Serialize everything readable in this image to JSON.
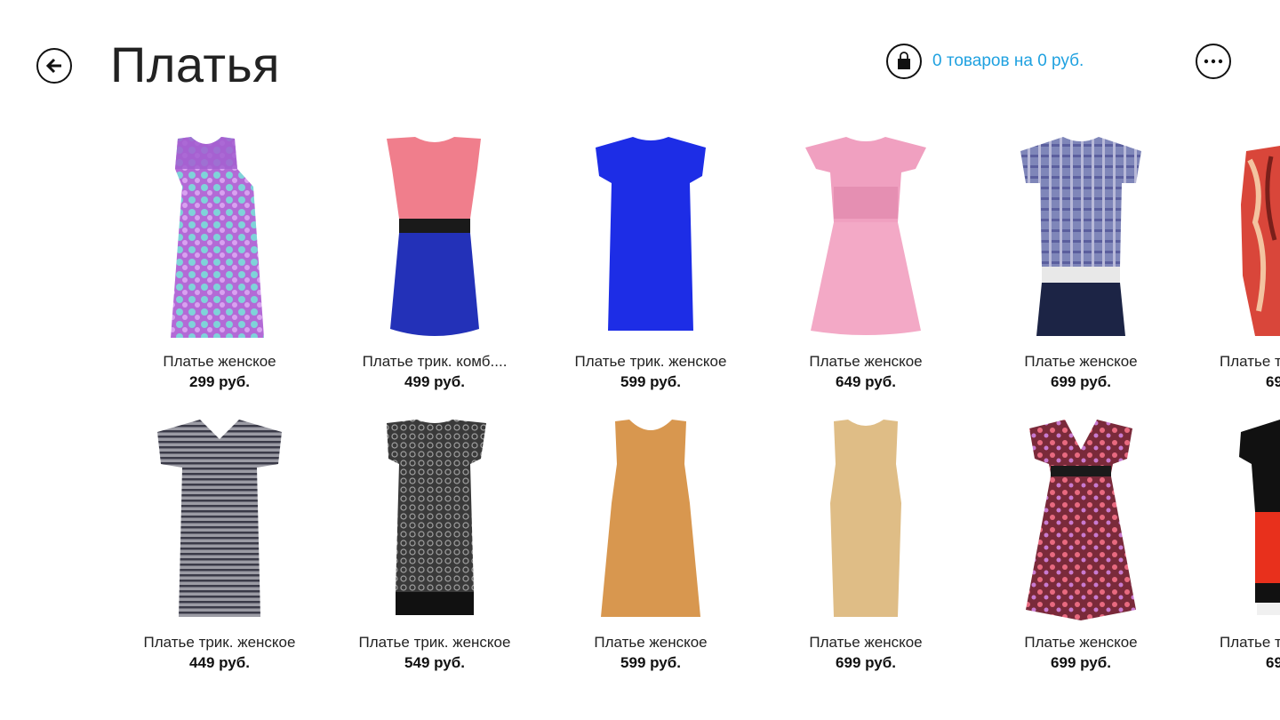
{
  "header": {
    "title": "Платья",
    "cart_summary": "0 товаров на 0 руб."
  },
  "colors": {
    "accent": "#1fa1e0"
  },
  "products": [
    {
      "name": "Платье женское",
      "price": "299 руб.",
      "icon": "sequin-dress-icon"
    },
    {
      "name": "Платье трик. комб....",
      "price": "499 руб.",
      "icon": "pink-blue-dress-icon"
    },
    {
      "name": "Платье трик. женское",
      "price": "599 руб.",
      "icon": "blue-dress-icon"
    },
    {
      "name": "Платье женское",
      "price": "649 руб.",
      "icon": "pink-dress-icon"
    },
    {
      "name": "Платье женское",
      "price": "699 руб.",
      "icon": "plaid-dress-icon"
    },
    {
      "name": "Платье т",
      "price": "69",
      "icon": "print-dress-icon"
    },
    {
      "name": "Платье трик. женское",
      "price": "449 руб.",
      "icon": "striped-dress-icon"
    },
    {
      "name": "Платье трик. женское",
      "price": "549 руб.",
      "icon": "lace-dress-icon"
    },
    {
      "name": "Платье женское",
      "price": "599 руб.",
      "icon": "orange-dress-icon"
    },
    {
      "name": "Платье женское",
      "price": "699 руб.",
      "icon": "beige-dress-icon"
    },
    {
      "name": "Платье женское",
      "price": "699 руб.",
      "icon": "floral-dress-icon"
    },
    {
      "name": "Платье т",
      "price": "69",
      "icon": "colorblock-dress-icon"
    }
  ]
}
